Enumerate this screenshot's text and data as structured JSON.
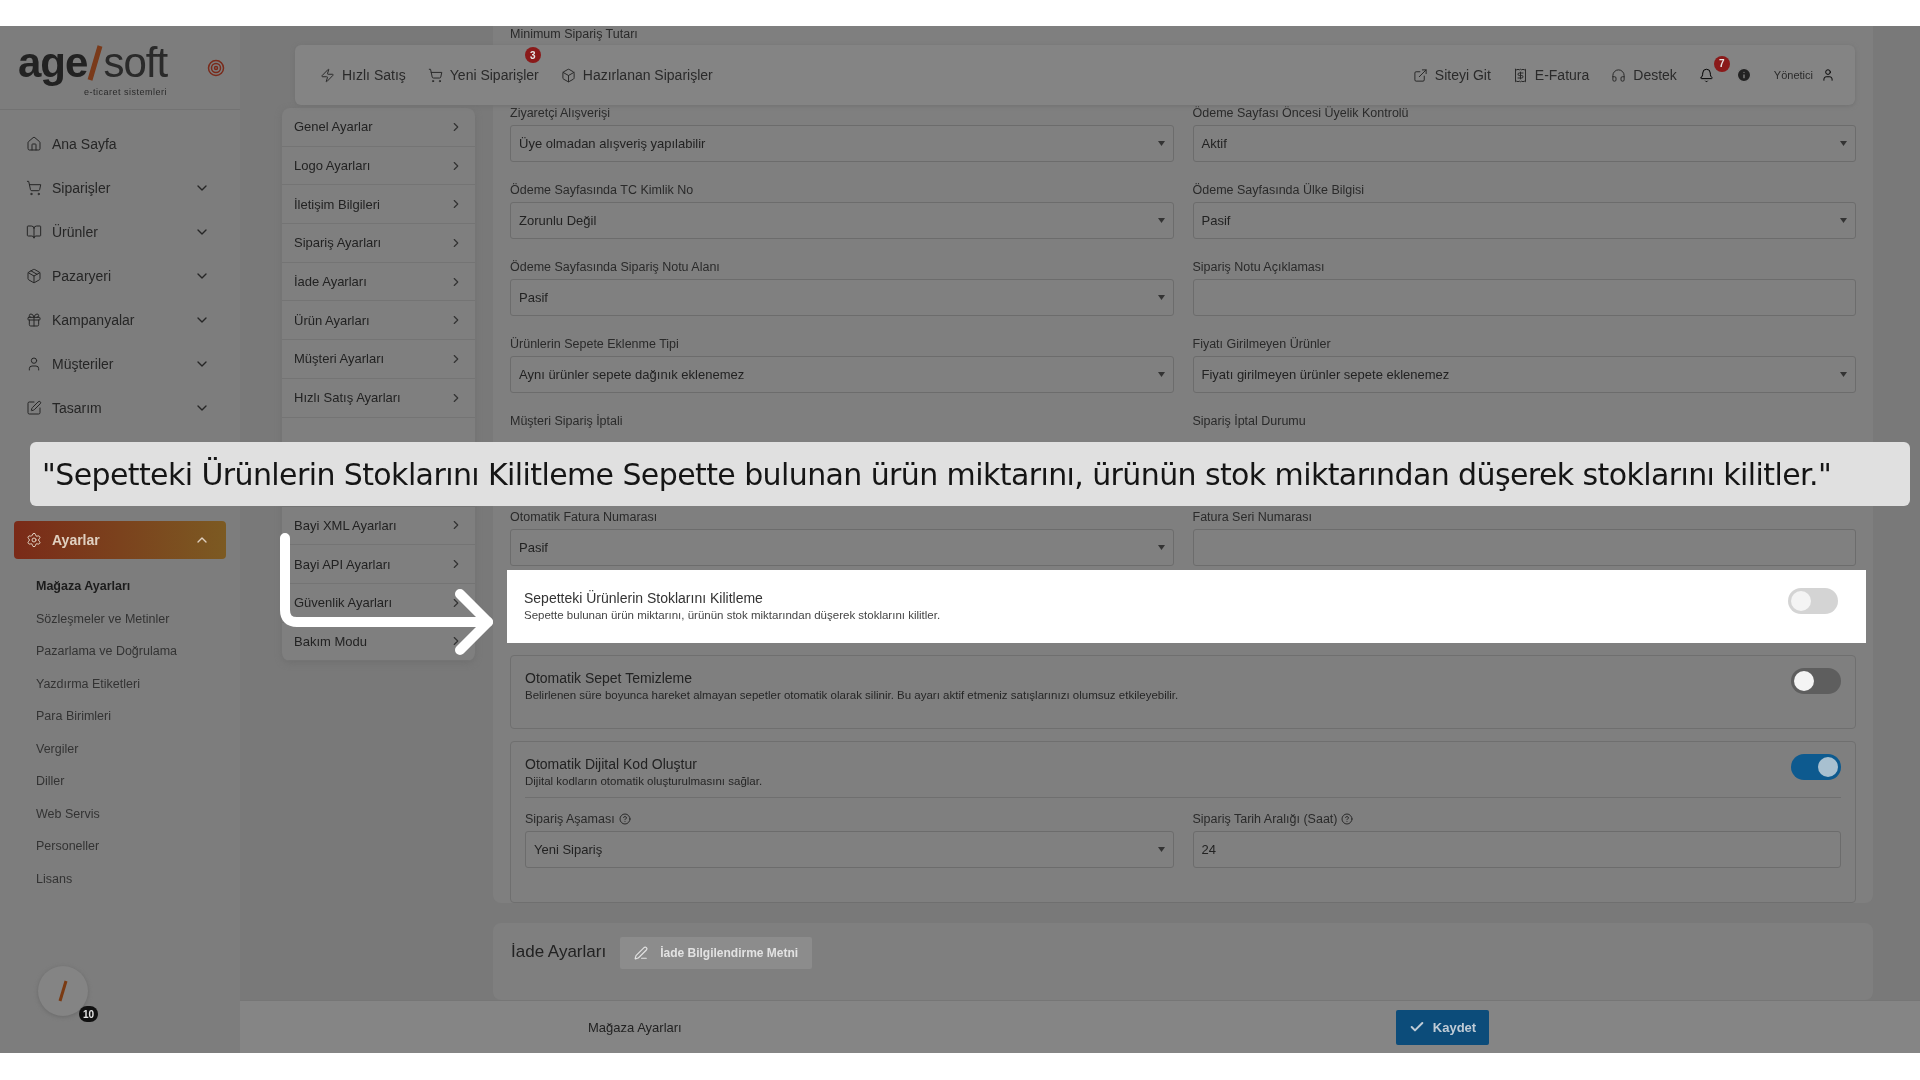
{
  "logo": {
    "main": "age",
    "light": "soft",
    "tagline": "e-ticaret sistemleri"
  },
  "sidebar": {
    "items": [
      {
        "label": "Ana Sayfa",
        "expandable": false,
        "selected": false
      },
      {
        "label": "Siparişler",
        "expandable": true,
        "expanded": false,
        "selected": false
      },
      {
        "label": "Ürünler",
        "expandable": true,
        "expanded": false,
        "selected": false
      },
      {
        "label": "Pazaryeri",
        "expandable": true,
        "expanded": false,
        "selected": false
      },
      {
        "label": "Kampanyalar",
        "expandable": true,
        "expanded": false,
        "selected": false
      },
      {
        "label": "Müşteriler",
        "expandable": true,
        "expanded": false,
        "selected": false
      },
      {
        "label": "Tasarım",
        "expandable": true,
        "expanded": false,
        "selected": false
      },
      {
        "label": "Ayarlar",
        "expandable": true,
        "expanded": true,
        "selected": true
      }
    ],
    "subitems": [
      {
        "label": "Mağaza Ayarları",
        "selected": true
      },
      {
        "label": "Sözleşmeler ve Metinler",
        "selected": false
      },
      {
        "label": "Pazarlama ve Doğrulama",
        "selected": false
      },
      {
        "label": "Yazdırma Etiketleri",
        "selected": false
      },
      {
        "label": "Para Birimleri",
        "selected": false
      },
      {
        "label": "Vergiler",
        "selected": false
      },
      {
        "label": "Diller",
        "selected": false
      },
      {
        "label": "Web Servis",
        "selected": false
      },
      {
        "label": "Personeller",
        "selected": false
      },
      {
        "label": "Lisans",
        "selected": false
      }
    ],
    "avatar_badge": "10"
  },
  "topbar": {
    "left": [
      {
        "label": "Hızlı Satış"
      },
      {
        "label": "Yeni Siparişler",
        "badge": "3"
      },
      {
        "label": "Hazırlanan Siparişler"
      }
    ],
    "right": [
      {
        "label": "Siteyi Git"
      },
      {
        "label": "E-Fatura"
      },
      {
        "label": "Destek"
      }
    ],
    "notifications_badge": "7",
    "user": "Yönetici"
  },
  "settings_menu": [
    "Genel Ayarlar",
    "Logo Ayarları",
    "İletişim Bilgileri",
    "Sipariş Ayarları",
    "İade Ayarları",
    "Ürün Ayarları",
    "Müşteri Ayarları",
    "Hızlı Satış Ayarları",
    "Bayi XML Ayarları",
    "Bayi API Ayarları",
    "Güvenlik Ayarları",
    "Bakım Modu"
  ],
  "form": {
    "fields": [
      {
        "label": "Minimum Sipariş Tutarı",
        "kind": "wide"
      },
      {
        "label": "Ziyaretçi Alışverişi",
        "kind": "select",
        "value": "Üye olmadan alışveriş yapılabilir"
      },
      {
        "label": "Ödeme Sayfası Öncesi Üyelik Kontrolü",
        "kind": "select",
        "value": "Aktif"
      },
      {
        "label": "Ödeme Sayfasında TC Kimlik No",
        "kind": "select",
        "value": "Zorunlu Değil"
      },
      {
        "label": "Ödeme Sayfasında Ülke Bilgisi",
        "kind": "select",
        "value": "Pasif"
      },
      {
        "label": "Ödeme Sayfasında Sipariş Notu Alanı",
        "kind": "select",
        "value": "Pasif"
      },
      {
        "label": "Sipariş Notu Açıklaması",
        "kind": "text"
      },
      {
        "label": "Ürünlerin Sepete Eklenme Tipi",
        "kind": "select",
        "value": "Aynı ürünler sepete dağınık eklenemez"
      },
      {
        "label": "Fiyatı Girilmeyen Ürünler",
        "kind": "select",
        "value": "Fiyatı girilmeyen ürünler sepete eklenemez"
      },
      {
        "label": "Müşteri Sipariş İptali"
      },
      {
        "label": "Sipariş İptal Durumu"
      },
      {
        "label": "Otomatik Fatura Numarası",
        "kind": "select",
        "value": "Pasif"
      },
      {
        "label": "Fatura Seri Numarası",
        "kind": "text"
      }
    ]
  },
  "toggle_cards": [
    {
      "title": "Sepetteki Ürünlerin Stoklarını Kilitleme",
      "description": "Sepette bulunan ürün miktarını, ürünün stok miktarından düşerek stoklarını kilitler.",
      "on": false,
      "highlighted": true
    },
    {
      "title": "Otomatik Sepet Temizleme",
      "description": "Belirlenen süre boyunca hareket almayan sepetler otomatik olarak silinir. Bu ayarı aktif etmeniz satışlarınızı olumsuz etkileyebilir.",
      "on": false,
      "highlighted": false
    },
    {
      "title": "Otomatik Dijital Kod Oluştur",
      "description": "Dijital kodların otomatik oluşturulmasını sağlar.",
      "on": true,
      "highlighted": false,
      "fields": [
        {
          "label": "Sipariş Aşaması",
          "kind": "select",
          "value": "Yeni Sipariş"
        },
        {
          "label": "Sipariş Tarih Aralığı (Saat)",
          "kind": "text",
          "value": "24"
        }
      ]
    }
  ],
  "return_section": {
    "title": "İade Ayarları",
    "button": "İade Bilgilendirme Metni"
  },
  "footer": {
    "breadcrumb": "Mağaza Ayarları",
    "save_button": "Kaydet"
  },
  "caption": "\"Sepetteki Ürünlerin Stoklarını Kilitleme Sepette bulunan ürün miktarını, ürünün stok miktarından düşerek stoklarını kilitler.\""
}
